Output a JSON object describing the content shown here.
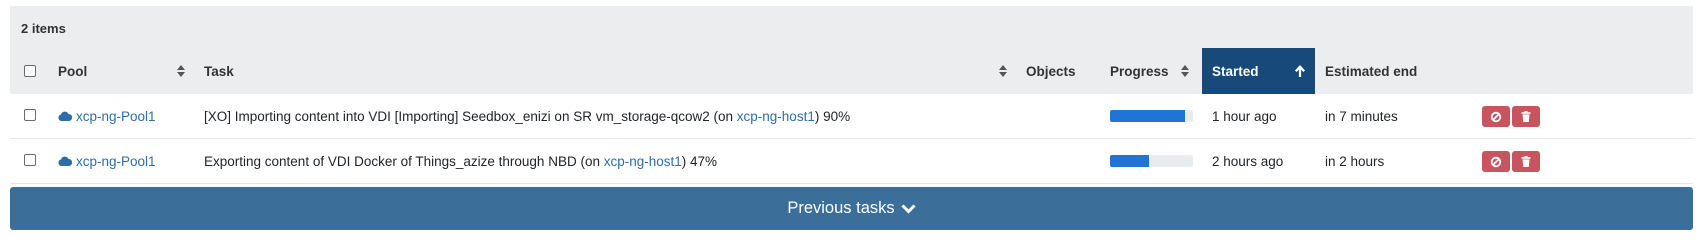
{
  "summary": {
    "count_label": "2 items"
  },
  "columns": {
    "pool": "Pool",
    "task": "Task",
    "objects": "Objects",
    "progress": "Progress",
    "started": "Started",
    "estimated_end": "Estimated end"
  },
  "rows": [
    {
      "pool": "xcp-ng-Pool1",
      "task_prefix": "[XO] Importing content into VDI [Importing] Seedbox_enizi on SR vm_storage-qcow2 (on ",
      "task_host": "xcp-ng-host1",
      "task_suffix": ") 90%",
      "progress": 0.9,
      "started": "1 hour ago",
      "estimated_end": "in 7 minutes"
    },
    {
      "pool": "xcp-ng-Pool1",
      "task_prefix": "Exporting content of VDI Docker of Things_azize through NBD (on ",
      "task_host": "xcp-ng-host1",
      "task_suffix": ") 47%",
      "progress": 0.47,
      "started": "2 hours ago",
      "estimated_end": "in 2 hours"
    }
  ],
  "footer": {
    "previous_tasks_label": "Previous tasks"
  },
  "colors": {
    "header_bg": "#ebedef",
    "sorted_header_bg": "#17497a",
    "progress_fill": "#1f74d6",
    "danger_button": "#c8545f",
    "previous_button": "#3b6e99",
    "link": "#2e6ea6"
  },
  "icons": {
    "pool": "cloud-icon",
    "cancel": "ban-icon",
    "delete": "trash-icon",
    "sort": "sort-icon",
    "sort_asc": "arrow-up-icon",
    "expand": "chevron-down-icon"
  }
}
